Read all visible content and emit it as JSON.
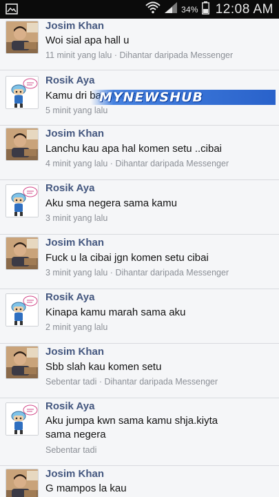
{
  "status_bar": {
    "battery_percent": "34%",
    "time": "12:08 AM",
    "icons": [
      "image-notification-icon",
      "wifi-icon",
      "signal-icon",
      "battery-icon"
    ]
  },
  "watermark": "MYNEWSHUB",
  "comments": [
    {
      "author": "Josim Khan",
      "avatar": "josim-photo",
      "text": "Woi sial apa hall u",
      "time": "11 minit yang lalu",
      "via": "Dihantar daripada Messenger"
    },
    {
      "author": "Rosik Aya",
      "avatar": "rosik-cartoon",
      "text": "Kamu dri bangladesh bukan",
      "time": "5 minit yang lalu",
      "via": ""
    },
    {
      "author": "Josim Khan",
      "avatar": "josim-photo",
      "text": "Lanchu kau apa hal komen setu ..cibai",
      "time": "4 minit yang lalu",
      "via": "Dihantar daripada Messenger"
    },
    {
      "author": "Rosik Aya",
      "avatar": "rosik-cartoon",
      "text": "Aku sma negera sama kamu",
      "time": "3 minit yang lalu",
      "via": ""
    },
    {
      "author": "Josim Khan",
      "avatar": "josim-photo",
      "text": "Fuck u la cibai jgn komen setu cibai",
      "time": "3 minit yang lalu",
      "via": "Dihantar daripada Messenger"
    },
    {
      "author": "Rosik Aya",
      "avatar": "rosik-cartoon",
      "text": "Kinapa kamu marah sama aku",
      "time": "2 minit yang lalu",
      "via": ""
    },
    {
      "author": "Josim Khan",
      "avatar": "josim-photo",
      "text": "Sbb slah kau komen setu",
      "time": "Sebentar tadi",
      "via": "Dihantar daripada Messenger"
    },
    {
      "author": "Rosik Aya",
      "avatar": "rosik-cartoon",
      "text": "Aku jumpa kwn sama kamu shja.kiyta sama negera",
      "time": "Sebentar tadi",
      "via": ""
    },
    {
      "author": "Josim Khan",
      "avatar": "josim-photo",
      "text": "G mampos la kau",
      "time": "",
      "via": ""
    }
  ]
}
